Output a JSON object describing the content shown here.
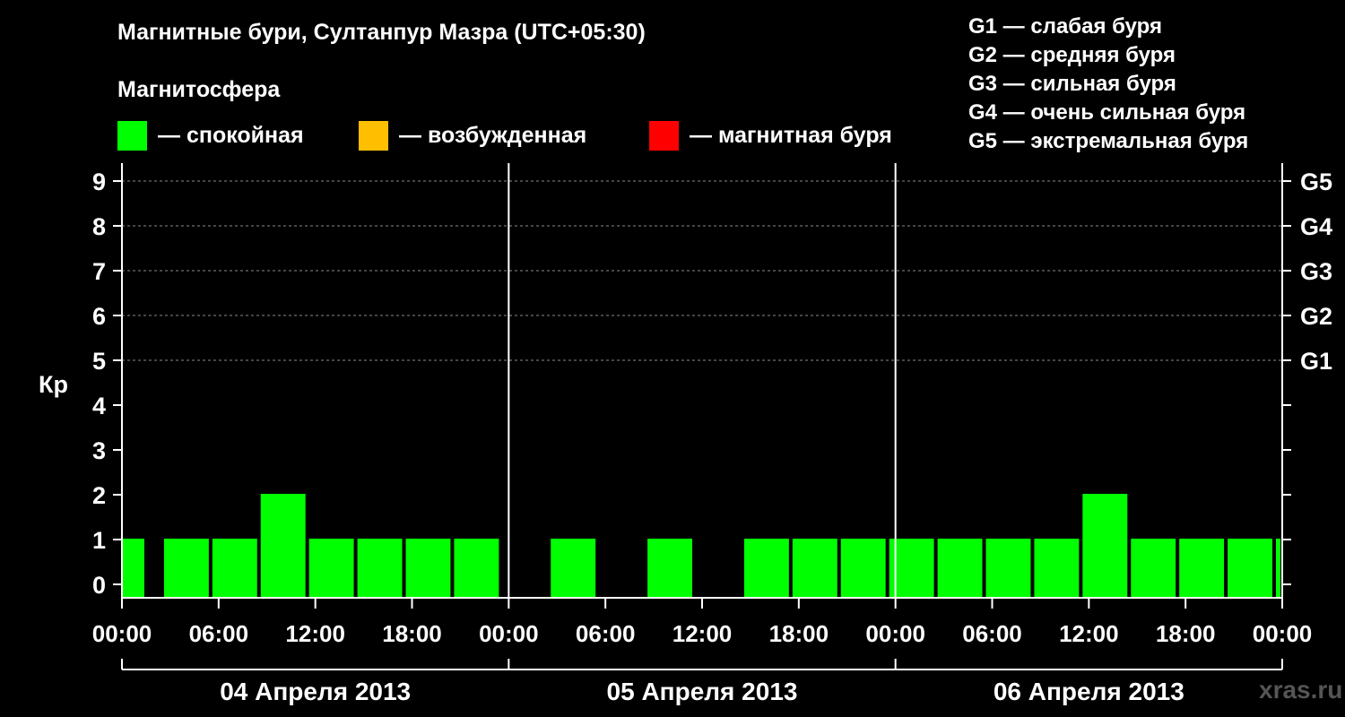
{
  "chart_data": {
    "type": "bar",
    "title": "Магнитные бури, Султанпур Мазра (UTC+05:30)",
    "subtitle": "Магнитосфера",
    "ylabel": "Кр",
    "ylim": [
      0,
      9
    ],
    "yticks": [
      "0",
      "1",
      "2",
      "3",
      "4",
      "5",
      "6",
      "7",
      "8",
      "9"
    ],
    "right_ticks": [
      {
        "value": 5,
        "label": "G1"
      },
      {
        "value": 6,
        "label": "G2"
      },
      {
        "value": 7,
        "label": "G3"
      },
      {
        "value": 8,
        "label": "G4"
      },
      {
        "value": 9,
        "label": "G5"
      }
    ],
    "grid_values": [
      5,
      6,
      7,
      8,
      9
    ],
    "xtick_labels": [
      "00:00",
      "06:00",
      "12:00",
      "18:00",
      "00:00",
      "06:00",
      "12:00",
      "18:00",
      "00:00",
      "06:00",
      "12:00",
      "18:00",
      "00:00"
    ],
    "x_hours_total": 72,
    "days": [
      "04 Апреля 2013",
      "05 Апреля 2013",
      "06 Апреля 2013"
    ],
    "colors": {
      "calm": "#00ff00",
      "excited": "#ffbf00",
      "storm": "#ff0000"
    },
    "legend": [
      {
        "key": "calm",
        "label": "— спокойная"
      },
      {
        "key": "excited",
        "label": "— возбужденная"
      },
      {
        "key": "storm",
        "label": "— магнитная буря"
      }
    ],
    "g_legend": [
      "G1 — слабая буря",
      "G2 — средняя буря",
      "G3 — сильная буря",
      "G4 — очень сильная буря",
      "G5 — экстремальная буря"
    ],
    "bars": [
      {
        "start": 0,
        "end": 1.5,
        "kp": 1
      },
      {
        "start": 2.5,
        "end": 5.5,
        "kp": 1
      },
      {
        "start": 5.5,
        "end": 8.5,
        "kp": 1
      },
      {
        "start": 8.5,
        "end": 11.5,
        "kp": 2
      },
      {
        "start": 11.5,
        "end": 14.5,
        "kp": 1
      },
      {
        "start": 14.5,
        "end": 17.5,
        "kp": 1
      },
      {
        "start": 17.5,
        "end": 20.5,
        "kp": 1
      },
      {
        "start": 20.5,
        "end": 23.5,
        "kp": 1
      },
      {
        "start": 23.5,
        "end": 26.5,
        "kp": 0
      },
      {
        "start": 26.5,
        "end": 29.5,
        "kp": 1
      },
      {
        "start": 29.5,
        "end": 32.5,
        "kp": 0
      },
      {
        "start": 32.5,
        "end": 35.5,
        "kp": 1
      },
      {
        "start": 35.5,
        "end": 38.5,
        "kp": 0
      },
      {
        "start": 38.5,
        "end": 41.5,
        "kp": 1
      },
      {
        "start": 41.5,
        "end": 44.5,
        "kp": 1
      },
      {
        "start": 44.5,
        "end": 47.5,
        "kp": 1
      },
      {
        "start": 47.5,
        "end": 50.5,
        "kp": 1
      },
      {
        "start": 50.5,
        "end": 53.5,
        "kp": 1
      },
      {
        "start": 53.5,
        "end": 56.5,
        "kp": 1
      },
      {
        "start": 56.5,
        "end": 59.5,
        "kp": 1
      },
      {
        "start": 59.5,
        "end": 62.5,
        "kp": 2
      },
      {
        "start": 62.5,
        "end": 65.5,
        "kp": 1
      },
      {
        "start": 65.5,
        "end": 68.5,
        "kp": 1
      },
      {
        "start": 68.5,
        "end": 71.5,
        "kp": 1
      },
      {
        "start": 71.5,
        "end": 72,
        "kp": 1
      }
    ]
  },
  "watermark": "xras.ru"
}
